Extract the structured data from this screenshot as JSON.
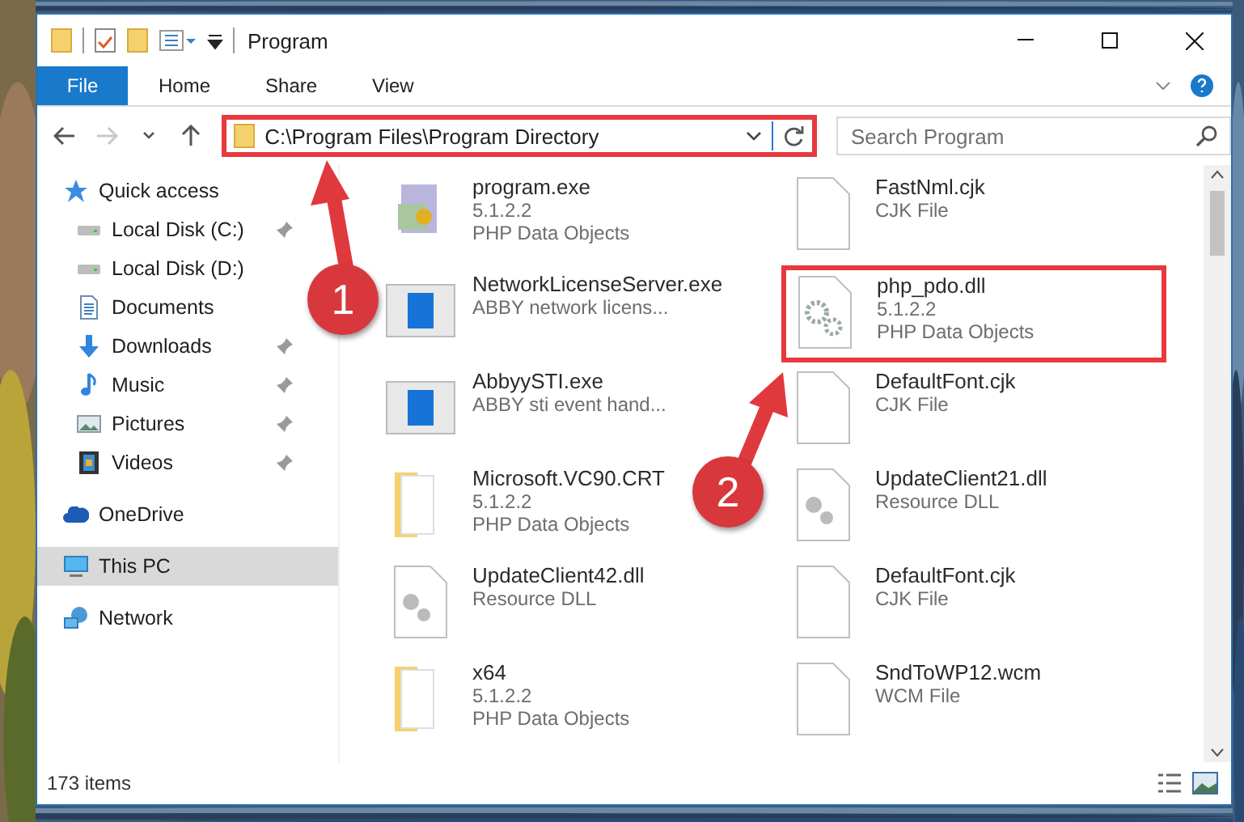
{
  "window": {
    "title": "Program"
  },
  "ribbon": {
    "tabs": [
      {
        "label": "File",
        "selected": true
      },
      {
        "label": "Home",
        "selected": false
      },
      {
        "label": "Share",
        "selected": false
      },
      {
        "label": "View",
        "selected": false
      }
    ]
  },
  "navigation": {
    "forward_disabled": true,
    "address": "C:\\Program Files\\Program Directory",
    "search": {
      "placeholder": "Search Program"
    }
  },
  "sidebar": {
    "items": [
      {
        "label": "Quick access",
        "kind": "star",
        "selected": false,
        "children": [
          {
            "label": "Local Disk (C:)",
            "kind": "drive",
            "pinned": true,
            "selected": false
          },
          {
            "label": "Local Disk (D:)",
            "kind": "drive",
            "pinned": false,
            "selected": false
          },
          {
            "label": "Documents",
            "kind": "document",
            "pinned": false,
            "selected": false
          },
          {
            "label": "Downloads",
            "kind": "download",
            "pinned": true,
            "selected": false
          },
          {
            "label": "Music",
            "kind": "music",
            "pinned": true,
            "selected": false
          },
          {
            "label": "Pictures",
            "kind": "pictures",
            "pinned": true,
            "selected": false
          },
          {
            "label": "Videos",
            "kind": "videos",
            "pinned": true,
            "selected": false
          }
        ]
      },
      {
        "label": "OneDrive",
        "kind": "cloud",
        "selected": false
      },
      {
        "label": "This PC",
        "kind": "pc",
        "selected": true
      },
      {
        "label": "Network",
        "kind": "network",
        "selected": false
      }
    ]
  },
  "files": [
    {
      "name": "program.exe",
      "details": [
        "5.1.2.2",
        "PHP Data Objects"
      ],
      "kind": "installer",
      "highlighted": false
    },
    {
      "name": "FastNml.cjk",
      "details": [
        "CJK File"
      ],
      "kind": "blank",
      "highlighted": false
    },
    {
      "name": "NetworkLicenseServer.exe",
      "details": [
        "ABBY network licens..."
      ],
      "kind": "app",
      "highlighted": false
    },
    {
      "name": "php_pdo.dll",
      "details": [
        "5.1.2.2",
        "PHP Data Objects"
      ],
      "kind": "gears",
      "highlighted": true
    },
    {
      "name": "AbbyySTI.exe",
      "details": [
        "ABBY sti event hand..."
      ],
      "kind": "app",
      "highlighted": false
    },
    {
      "name": "DefaultFont.cjk",
      "details": [
        "CJK File"
      ],
      "kind": "blank",
      "highlighted": false
    },
    {
      "name": "Microsoft.VC90.CRT",
      "details": [
        "5.1.2.2",
        "PHP Data Objects"
      ],
      "kind": "folder",
      "highlighted": false
    },
    {
      "name": "UpdateClient21.dll",
      "details": [
        "Resource DLL"
      ],
      "kind": "dll",
      "highlighted": false
    },
    {
      "name": "UpdateClient42.dll",
      "details": [
        "Resource DLL"
      ],
      "kind": "dll",
      "highlighted": false
    },
    {
      "name": "DefaultFont.cjk",
      "details": [
        "CJK File"
      ],
      "kind": "blank",
      "highlighted": false
    },
    {
      "name": "x64",
      "details": [
        "5.1.2.2",
        "PHP Data Objects"
      ],
      "kind": "folder",
      "highlighted": false
    },
    {
      "name": "SndToWP12.wcm",
      "details": [
        "WCM File"
      ],
      "kind": "blank",
      "highlighted": false
    }
  ],
  "status_bar": {
    "count": "173 items"
  },
  "annotations": {
    "address_highlighted": true,
    "steps": [
      {
        "number": "1"
      },
      {
        "number": "2"
      }
    ]
  }
}
